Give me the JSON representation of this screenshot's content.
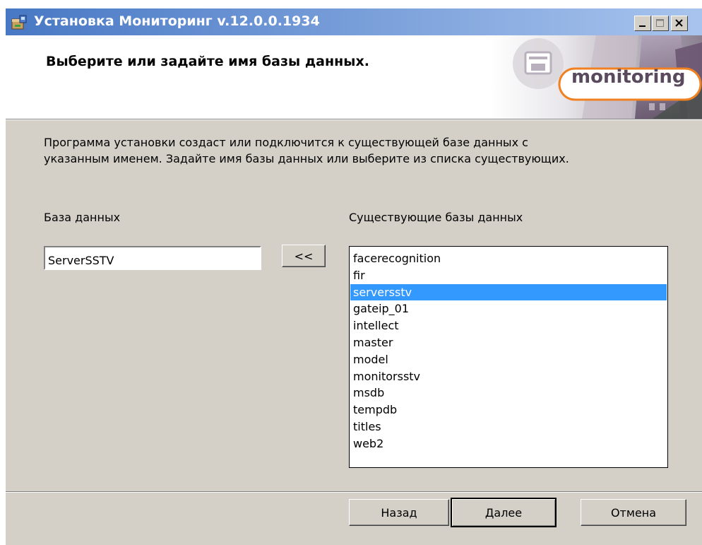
{
  "window": {
    "title": "Установка Мониторинг v.12.0.0.1934",
    "caption_buttons": {
      "minimize": "minimize-icon",
      "maximize": "maximize-icon",
      "close": "close-icon"
    }
  },
  "header": {
    "title": "Выберите или задайте имя базы данных.",
    "brand": "monitoring"
  },
  "description": {
    "line1": "Программа установки создаст или подключится к существующей базе данных с",
    "line2": "указанным именем. Задайте имя базы данных или выберите из списка существующих."
  },
  "database": {
    "label": "База данных",
    "value": "ServerSSTV"
  },
  "transfer_button": {
    "label": "<<"
  },
  "existing": {
    "label": "Существующие базы данных",
    "items": [
      "facerecognition",
      "fir",
      "serversstv",
      "gateip_01",
      "intellect",
      "master",
      "model",
      "monitorsstv",
      "msdb",
      "tempdb",
      "titles",
      "web2"
    ],
    "selected_index": 2
  },
  "footer": {
    "back": "Назад",
    "next": "Далее",
    "cancel": "Отмена"
  },
  "colors": {
    "title_bar_start": "#4878c4",
    "title_bar_end": "#a8c4ee",
    "dialog_bg": "#d4d0c8",
    "selection": "#3399ff",
    "brand_orange": "#f08020"
  }
}
